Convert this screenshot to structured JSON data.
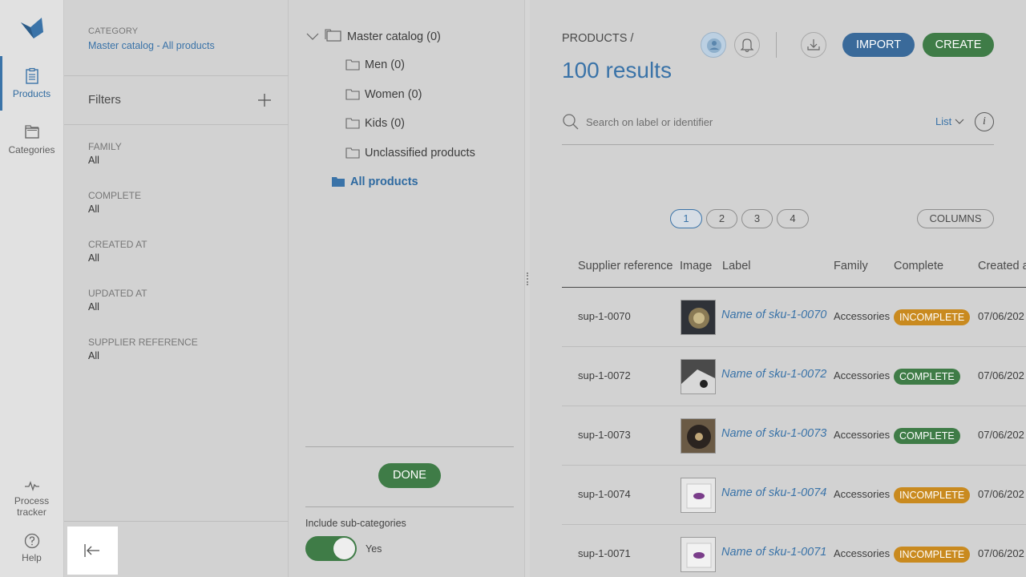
{
  "nav": {
    "items": [
      {
        "label": "Products",
        "icon": "clipboard-icon"
      },
      {
        "label": "Categories",
        "icon": "folders-icon"
      }
    ],
    "bottom": [
      {
        "label": "Process tracker",
        "icon": "pulse-icon"
      },
      {
        "label": "Help",
        "icon": "help-circle-icon"
      }
    ]
  },
  "filters": {
    "category_label": "CATEGORY",
    "category_value": "Master catalog - All products",
    "title": "Filters",
    "items": [
      {
        "label": "FAMILY",
        "value": "All"
      },
      {
        "label": "COMPLETE",
        "value": "All"
      },
      {
        "label": "CREATED AT",
        "value": "All"
      },
      {
        "label": "UPDATED AT",
        "value": "All"
      },
      {
        "label": "SUPPLIER REFERENCE",
        "value": "All"
      }
    ]
  },
  "tree": {
    "root": "Master catalog (0)",
    "children": [
      "Men (0)",
      "Women (0)",
      "Kids (0)",
      "Unclassified products"
    ],
    "selected": "All products",
    "done_label": "DONE",
    "include_sub_label": "Include sub-categories",
    "toggle_value": "Yes"
  },
  "main": {
    "breadcrumb": "PRODUCTS /",
    "results": "100 results",
    "import_label": "IMPORT",
    "create_label": "CREATE",
    "search_placeholder": "Search on label or identifier",
    "view_label": "List",
    "info_glyph": "i",
    "pages": [
      "1",
      "2",
      "3",
      "4"
    ],
    "current_page": "1",
    "columns_label": "COLUMNS",
    "headers": [
      "Supplier reference",
      "Image",
      "Label",
      "Family",
      "Complete",
      "Created a"
    ],
    "rows": [
      {
        "ref": "sup-1-0070",
        "label": "Name of sku-1-0070",
        "family": "Accessories",
        "status": "INCOMPLETE",
        "created": "07/06/202"
      },
      {
        "ref": "sup-1-0072",
        "label": "Name of sku-1-0072",
        "family": "Accessories",
        "status": "COMPLETE",
        "created": "07/06/202"
      },
      {
        "ref": "sup-1-0073",
        "label": "Name of sku-1-0073",
        "family": "Accessories",
        "status": "COMPLETE",
        "created": "07/06/202"
      },
      {
        "ref": "sup-1-0074",
        "label": "Name of sku-1-0074",
        "family": "Accessories",
        "status": "INCOMPLETE",
        "created": "07/06/202"
      },
      {
        "ref": "sup-1-0071",
        "label": "Name of sku-1-0071",
        "family": "Accessories",
        "status": "INCOMPLETE",
        "created": "07/06/202"
      }
    ]
  },
  "colors": {
    "accent": "#3a73a8",
    "success": "#3f7c47",
    "warning": "#c98a1f",
    "overlay": "#d2d2d2"
  }
}
